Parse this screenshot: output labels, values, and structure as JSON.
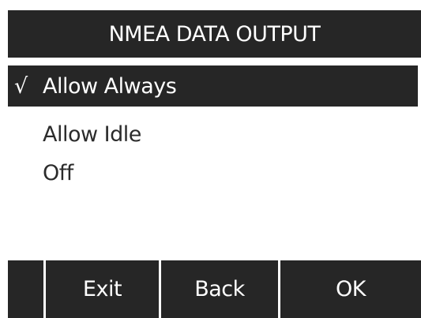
{
  "header": {
    "title": "NMEA DATA OUTPUT"
  },
  "menu": {
    "items": [
      {
        "label": "Allow Always",
        "selected": true,
        "check": "√"
      },
      {
        "label": "Allow Idle",
        "selected": false,
        "check": ""
      },
      {
        "label": "Off",
        "selected": false,
        "check": ""
      }
    ]
  },
  "softkeys": {
    "left": "",
    "exit": "Exit",
    "back": "Back",
    "ok": "OK"
  },
  "colors": {
    "background": "#ffffff",
    "bar": "#262626",
    "text": "#2b2b2b",
    "inverse_text": "#ffffff"
  }
}
